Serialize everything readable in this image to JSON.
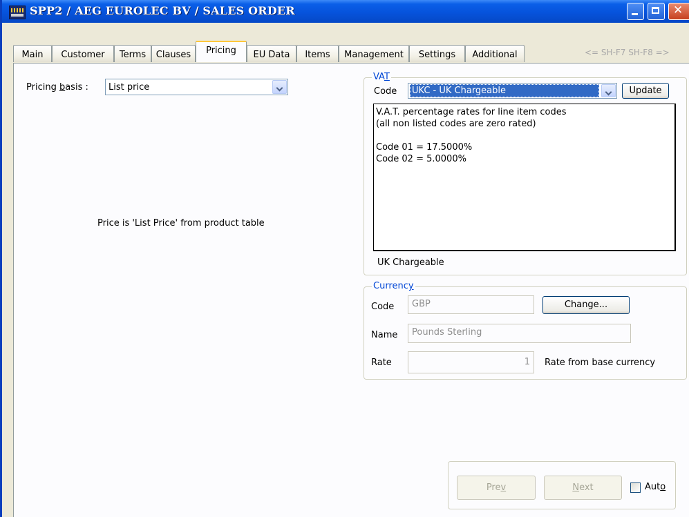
{
  "window": {
    "title": "SPP2 / AEG EUROLEC BV / SALES ORDER"
  },
  "tabs": [
    {
      "label": "Main",
      "active": false
    },
    {
      "label": "Customer",
      "active": false
    },
    {
      "label": "Terms",
      "active": false
    },
    {
      "label": "Clauses",
      "active": false
    },
    {
      "label": "Pricing",
      "active": true
    },
    {
      "label": "EU Data",
      "active": false
    },
    {
      "label": "Items",
      "active": false
    },
    {
      "label": "Management",
      "active": false
    },
    {
      "label": "Settings",
      "active": false
    },
    {
      "label": "Additional",
      "active": false
    }
  ],
  "shortcut_hint": "<= SH-F7 SH-F8 =>",
  "pricing": {
    "basis_label_pre": "Pricing ",
    "basis_label_accel": "b",
    "basis_label_post": "asis :",
    "basis_value": "List price",
    "note": "Price is 'List Price' from product table"
  },
  "vat": {
    "legend_pre": "VA",
    "legend_accel": "T",
    "code_label": "Code",
    "code_value": "UKC - UK Chargeable",
    "update_button": "Update",
    "rates_text": [
      "V.A.T. percentage rates for line item codes",
      "(all non listed codes are zero rated)",
      "",
      "Code 01 = 17.5000%",
      "Code 02 = 5.0000%"
    ],
    "description": "UK Chargeable"
  },
  "currency": {
    "legend_pre": "Currenc",
    "legend_accel": "y",
    "code_label": "Code",
    "code_value": "GBP",
    "change_button": "Change...",
    "name_label": "Name",
    "name_value": "Pounds Sterling",
    "rate_label": "Rate",
    "rate_value": "1",
    "rate_note": "Rate from base currency"
  },
  "nav": {
    "prev_pre": "Pre",
    "prev_accel": "v",
    "next_accel": "N",
    "next_post": "ext",
    "auto_pre": "Aut",
    "auto_accel": "o",
    "auto_checked": false
  }
}
